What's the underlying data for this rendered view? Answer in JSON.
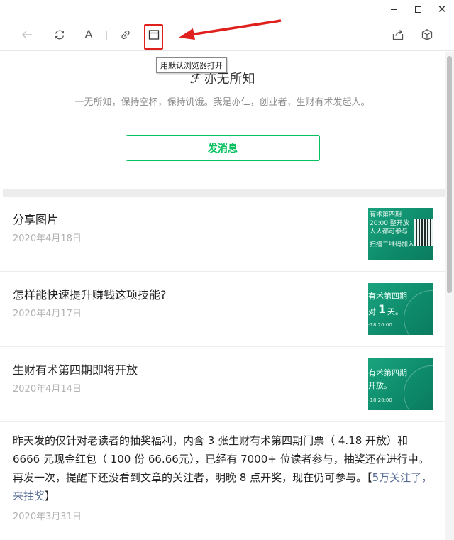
{
  "window": {
    "minimize_icon": "minimize-icon",
    "maximize_icon": "maximize-icon",
    "close_icon": "close-icon"
  },
  "toolbar": {
    "back_icon": "arrow-left-icon",
    "refresh_icon": "refresh-icon",
    "font_label": "A",
    "link_icon": "link-icon",
    "browser_icon": "browser-window-icon",
    "share_icon": "share-icon",
    "cube_icon": "cube-icon",
    "tooltip": "用默认浏览器打开",
    "annotation_color": "#e0201c"
  },
  "profile": {
    "name": "亦无所知",
    "description": "一无所知，保持空杯，保持饥饿。我是亦仁，创业者，生财有术发起人。",
    "message_button": "发消息",
    "accent": "#07c160"
  },
  "articles": [
    {
      "title": "分享图片",
      "date": "2020年4月18日",
      "thumb_lines": [
        "有术第四期",
        "20:00 整开放",
        "人人都可参与",
        "扫描二维码加入"
      ]
    },
    {
      "title": "怎样能快速提升赚钱这项技能?",
      "date": "2020年4月17日",
      "thumb_lines": [
        "有术第四期",
        "对",
        "1",
        "天。",
        "-18 20:00"
      ]
    },
    {
      "title": "生财有术第四期即将开放",
      "date": "2020年4月14日",
      "thumb_lines": [
        "有术第四期",
        "开放。",
        "-18 20:00"
      ]
    }
  ],
  "long_post": {
    "text": "昨天发的仅针对老读者的抽奖福利，内含 3 张生财有术第四期门票（ 4.18 开放）和 6666 元现金红包（ 100 份 66.66元），已经有 7000+ 位读者参与，抽奖还在进行中。 再发一次，提醒下还没看到文章的关注者，明晚 8 点开奖，现在仍可参与。【",
    "link": "5万关注了，来抽奖",
    "tail": "】",
    "date": "2020年3月31日"
  }
}
